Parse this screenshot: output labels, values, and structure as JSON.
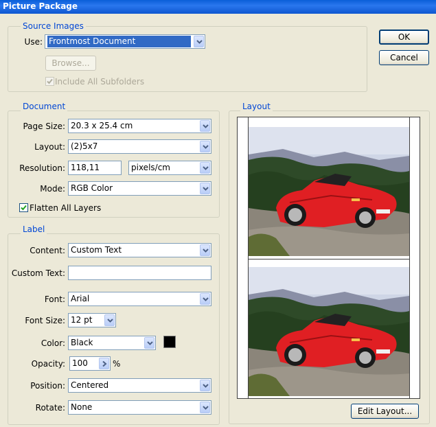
{
  "window": {
    "title": "Picture Package"
  },
  "source_images": {
    "legend": "Source Images",
    "use_label": "Use:",
    "use_value": "Frontmost Document",
    "browse_label": "Browse...",
    "include_subfolders_label": "Include All Subfolders",
    "include_subfolders_checked": true
  },
  "buttons": {
    "ok": "OK",
    "cancel": "Cancel",
    "edit_layout": "Edit Layout..."
  },
  "document": {
    "legend": "Document",
    "page_size_label": "Page Size:",
    "page_size_value": "20.3 x 25.4 cm",
    "layout_label": "Layout:",
    "layout_value": "(2)5x7",
    "resolution_label": "Resolution:",
    "resolution_value": "118,11",
    "resolution_unit": "pixels/cm",
    "mode_label": "Mode:",
    "mode_value": "RGB Color",
    "flatten_label": "Flatten All Layers",
    "flatten_checked": true
  },
  "label": {
    "legend": "Label",
    "content_label": "Content:",
    "content_value": "Custom Text",
    "custom_text_label": "Custom Text:",
    "custom_text_value": "",
    "font_label": "Font:",
    "font_value": "Arial",
    "font_size_label": "Font Size:",
    "font_size_value": "12 pt",
    "color_label": "Color:",
    "color_value": "Black",
    "color_swatch": "#000000",
    "opacity_label": "Opacity:",
    "opacity_value": "100",
    "opacity_unit": "%",
    "position_label": "Position:",
    "position_value": "Centered",
    "rotate_label": "Rotate:",
    "rotate_value": "None"
  },
  "layout_preview": {
    "legend": "Layout",
    "car_color": "#e01f23"
  }
}
